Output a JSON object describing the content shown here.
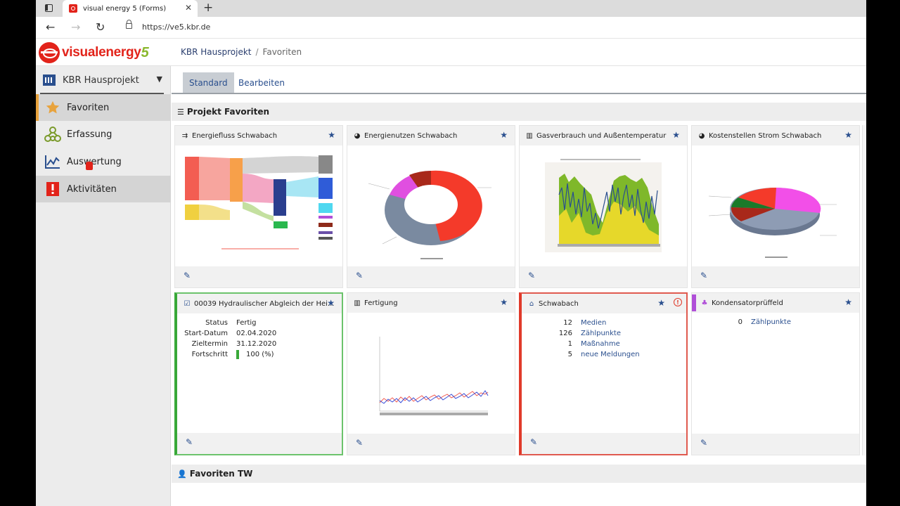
{
  "browser": {
    "tab_title": "visual energy 5 (Forms)",
    "url": "https://ve5.kbr.de"
  },
  "app": {
    "logo_text": "visualenergy",
    "logo_number": "5",
    "breadcrumb": [
      "KBR Hausprojekt",
      "Favoriten"
    ],
    "brand_color": "#e2231a"
  },
  "sidebar": {
    "project": "KBR Hausprojekt",
    "items": [
      {
        "label": "Favoriten",
        "icon": "star-icon",
        "active": true
      },
      {
        "label": "Erfassung",
        "icon": "hierarchy-icon"
      },
      {
        "label": "Auswertung",
        "icon": "line-chart-icon"
      },
      {
        "label": "Aktivitäten",
        "icon": "alert-icon"
      }
    ]
  },
  "tabs": [
    {
      "label": "Standard",
      "active": true
    },
    {
      "label": "Bearbeiten"
    }
  ],
  "sections": {
    "projekt": "Projekt Favoriten",
    "tw": "Favoriten TW"
  },
  "cards": [
    {
      "title": "Energiefluss Schwabach",
      "icon": "flow-icon"
    },
    {
      "title": "Energienutzen Schwabach",
      "icon": "pie-icon"
    },
    {
      "title": "Gasverbrauch und Außentemperatur",
      "icon": "bar-chart-icon"
    },
    {
      "title": "Kostenstellen Strom Schwabach",
      "icon": "pie-icon"
    },
    {
      "title": "00039 Hydraulischer Abgleich der Hei...",
      "icon": "task-icon",
      "fields": [
        {
          "k": "Status",
          "v": "Fertig"
        },
        {
          "k": "Start-Datum",
          "v": "02.04.2020"
        },
        {
          "k": "Zieltermin",
          "v": "31.12.2020"
        },
        {
          "k": "Fortschritt",
          "v": "100 (%)"
        }
      ],
      "progress": 1.0
    },
    {
      "title": "Fertigung",
      "icon": "bar-chart-icon"
    },
    {
      "title": "Schwabach",
      "icon": "home-icon",
      "counts": [
        {
          "n": "12",
          "l": "Medien"
        },
        {
          "n": "126",
          "l": "Zählpunkte"
        },
        {
          "n": "1",
          "l": "Maßnahme"
        },
        {
          "n": "5",
          "l": "neue Meldungen"
        }
      ]
    },
    {
      "title": "Kondensatorprüffeld",
      "icon": "hierarchy-icon",
      "counts": [
        {
          "n": "0",
          "l": "Zählpunkte"
        }
      ]
    }
  ],
  "colors": {
    "accent_blue": "#2a4f8e",
    "green_border": "#6cc36c",
    "red_border": "#e05a4f",
    "purple_marker": "#b04fd8"
  }
}
